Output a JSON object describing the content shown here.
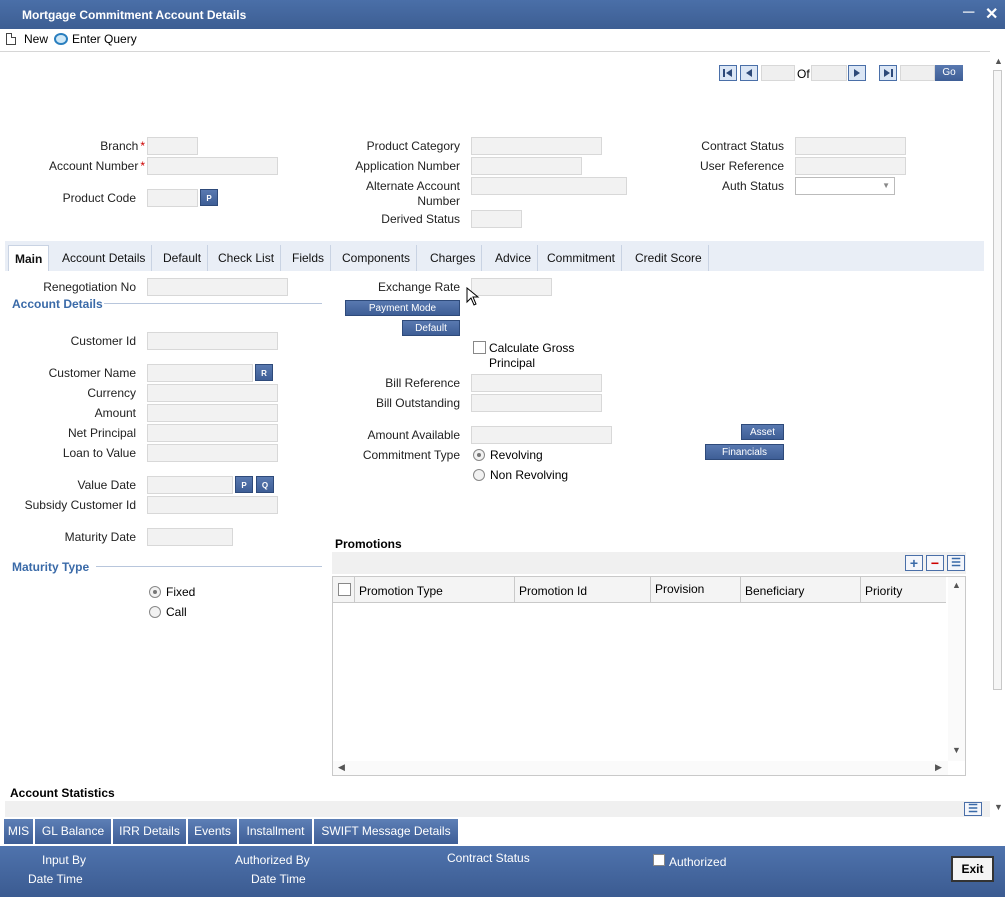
{
  "window": {
    "title": "Mortgage Commitment Account Details"
  },
  "toolbar": {
    "new_label": "New",
    "query_label": "Enter Query"
  },
  "nav": {
    "of_label": "Of",
    "go_label": "Go"
  },
  "header": {
    "branch_label": "Branch",
    "account_number_label": "Account Number",
    "product_code_label": "Product Code",
    "product_category_label": "Product Category",
    "application_number_label": "Application Number",
    "alternate_account_label_1": "Alternate Account",
    "alternate_account_label_2": "Number",
    "derived_status_label": "Derived Status",
    "contract_status_label": "Contract Status",
    "user_reference_label": "User Reference",
    "auth_status_label": "Auth Status",
    "required_mark": "*",
    "p_button": "P"
  },
  "tabs": [
    "Main",
    "Account Details",
    "Default",
    "Check List",
    "Fields",
    "Components",
    "Charges",
    "Advice",
    "Commitment",
    "Credit Score"
  ],
  "main": {
    "renegotiation_no_label": "Renegotiation No",
    "account_details_title": "Account Details",
    "customer_id_label": "Customer Id",
    "customer_name_label": "Customer Name",
    "currency_label": "Currency",
    "amount_label": "Amount",
    "net_principal_label": "Net Principal",
    "loan_to_value_label": "Loan to Value",
    "value_date_label": "Value Date",
    "subsidy_customer_id_label": "Subsidy Customer Id",
    "maturity_date_label": "Maturity Date",
    "maturity_type_title": "Maturity Type",
    "fixed_label": "Fixed",
    "call_label": "Call",
    "r_button": "R",
    "p_button": "P",
    "q_button": "Q",
    "exchange_rate_label": "Exchange Rate",
    "payment_mode_button": "Payment Mode",
    "default_button": "Default",
    "calculate_gross_label_1": "Calculate Gross",
    "calculate_gross_label_2": "Principal",
    "bill_reference_label": "Bill Reference",
    "bill_outstanding_label": "Bill Outstanding",
    "amount_available_label": "Amount Available",
    "commitment_type_label": "Commitment Type",
    "revolving_label": "Revolving",
    "non_revolving_label": "Non Revolving",
    "asset_button": "Asset",
    "financials_button": "Financials"
  },
  "promotions": {
    "title": "Promotions",
    "columns": [
      "Promotion Type",
      "Promotion Id",
      "Provision",
      "Beneficiary",
      "Priority"
    ]
  },
  "account_statistics_title": "Account Statistics",
  "bottom_tabs": [
    "MIS",
    "GL Balance",
    "IRR Details",
    "Events",
    "Installment",
    "SWIFT Message Details"
  ],
  "footer": {
    "input_by_label": "Input By",
    "date_time_label_1": "Date Time",
    "authorized_by_label": "Authorized By",
    "date_time_label_2": "Date Time",
    "contract_status_label": "Contract Status",
    "authorized_label": "Authorized",
    "exit_button": "Exit"
  }
}
